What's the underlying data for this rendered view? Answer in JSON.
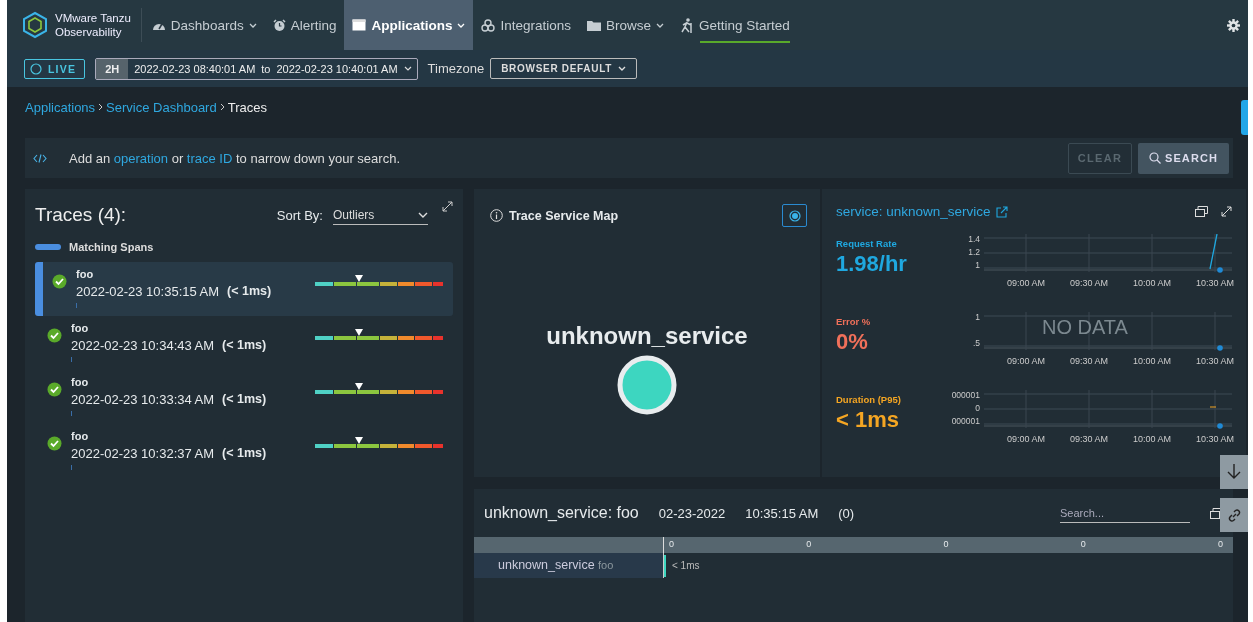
{
  "brand": {
    "line1": "VMware Tanzu",
    "line2": "Observability"
  },
  "nav": [
    {
      "label": "Dashboards",
      "caret": true,
      "selected": false,
      "underlined": false
    },
    {
      "label": "Alerting",
      "caret": false,
      "selected": false,
      "underlined": false
    },
    {
      "label": "Applications",
      "caret": true,
      "selected": true,
      "underlined": false
    },
    {
      "label": "Integrations",
      "caret": false,
      "selected": false,
      "underlined": false
    },
    {
      "label": "Browse",
      "caret": true,
      "selected": false,
      "underlined": false
    },
    {
      "label": "Getting Started",
      "caret": false,
      "selected": false,
      "underlined": true
    }
  ],
  "timebar": {
    "live": "LIVE",
    "range": "2H",
    "start": "2022-02-23 08:40:01 AM",
    "to": "to",
    "end": "2022-02-23 10:40:01 AM",
    "timezone_label": "Timezone",
    "timezone": "BROWSER DEFAULT"
  },
  "breadcrumb": [
    {
      "label": "Applications",
      "link": true
    },
    {
      "label": "Service Dashboard",
      "link": true
    },
    {
      "label": "Traces",
      "link": false
    }
  ],
  "query": {
    "parts": [
      {
        "text": "Add an ",
        "link": false
      },
      {
        "text": "operation",
        "link": true
      },
      {
        "text": " or ",
        "link": false
      },
      {
        "text": "trace ID",
        "link": true
      },
      {
        "text": " to narrow down your search.",
        "link": false
      }
    ],
    "clear": "CLEAR",
    "search": "SEARCH"
  },
  "traces": {
    "title": "Traces (4):",
    "sort_label": "Sort By:",
    "sort_value": "Outliers",
    "legend": "Matching Spans",
    "rows": [
      {
        "name": "foo",
        "time": "2022-02-23 10:35:15 AM",
        "duration": "(< 1ms)",
        "selected": true
      },
      {
        "name": "foo",
        "time": "2022-02-23 10:34:43 AM",
        "duration": "(< 1ms)",
        "selected": false
      },
      {
        "name": "foo",
        "time": "2022-02-23 10:33:34 AM",
        "duration": "(< 1ms)",
        "selected": false
      },
      {
        "name": "foo",
        "time": "2022-02-23 10:32:37 AM",
        "duration": "(< 1ms)",
        "selected": false
      }
    ]
  },
  "service_map": {
    "title": "Trace Service Map",
    "node": "unknown_service"
  },
  "service": {
    "title": "service: unknown_service",
    "metrics": [
      {
        "label": "Request Rate",
        "value": "1.98/hr",
        "color": "#1fa8e0",
        "yticks": [
          "1.4",
          "1.2",
          "1"
        ],
        "xticks": [
          "09:00 AM",
          "09:30 AM",
          "10:00 AM",
          "10:30 AM"
        ],
        "kind": "line"
      },
      {
        "label": "Error %",
        "value": "0%",
        "color": "#f0705a",
        "yticks": [
          "1",
          ".5"
        ],
        "xticks": [
          "09:00 AM",
          "09:30 AM",
          "10:00 AM",
          "10:30 AM"
        ],
        "kind": "empty",
        "overlay": "NO DATA"
      },
      {
        "label": "Duration (P95)",
        "value": "< 1ms",
        "color": "#f5a623",
        "yticks": [
          "000001",
          "0",
          "000001"
        ],
        "xticks": [
          "09:00 AM",
          "09:30 AM",
          "10:00 AM",
          "10:30 AM"
        ],
        "kind": "flat"
      }
    ]
  },
  "trace_detail": {
    "title": "unknown_service: foo",
    "date": "02-23-2022",
    "time": "10:35:15 AM",
    "count": "(0)",
    "search_placeholder": "Search...",
    "ticks": [
      "0",
      "0",
      "0",
      "0",
      "0"
    ],
    "spans": [
      {
        "service": "unknown_service",
        "operation": "foo",
        "duration": "< 1ms"
      }
    ]
  }
}
